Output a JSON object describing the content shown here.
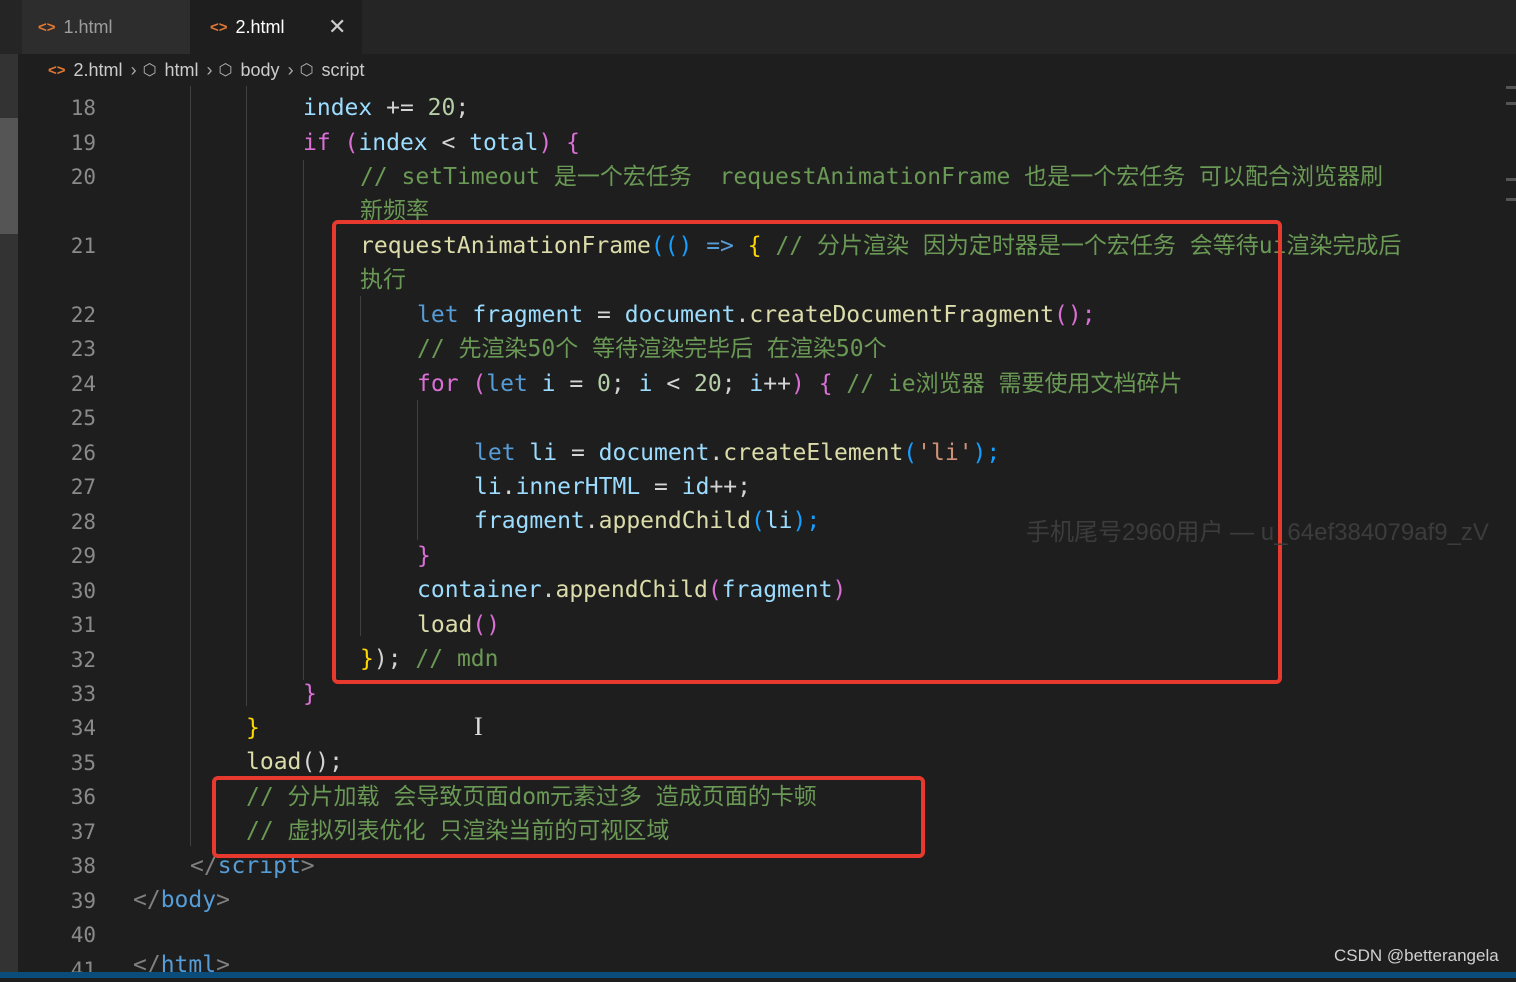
{
  "tabs": [
    {
      "label": "1.html",
      "icon": "code-file-icon"
    },
    {
      "label": "2.html",
      "icon": "code-file-icon",
      "close": "✕"
    }
  ],
  "breadcrumb": [
    "2.html",
    "html",
    "body",
    "script"
  ],
  "line_numbers": [
    "18",
    "19",
    "20",
    "",
    "21",
    "",
    "22",
    "23",
    "24",
    "25",
    "26",
    "27",
    "28",
    "29",
    "30",
    "31",
    "32",
    "33",
    "34",
    "35",
    "36",
    "37",
    "38",
    "39",
    "40",
    "41"
  ],
  "code": {
    "l18": {
      "a": "index",
      "b": " += ",
      "c": "20",
      "d": ";"
    },
    "l19": {
      "a": "if",
      "b": " (",
      "c": "index",
      "d": " < ",
      "e": "total",
      "f": ") ",
      "g": "{"
    },
    "l20": "// setTimeout 是一个宏任务  requestAnimationFrame 也是一个宏任务 可以配合浏览器刷",
    "l20b": "新频率",
    "l21": {
      "a": "requestAnimationFrame",
      "b": "((",
      "c": ") ",
      "d": "=>",
      "e": " {",
      "f": " // 分片渲染 因为定时器是一个宏任务 会等待ui渲染完成后"
    },
    "l21b": "执行",
    "l22": {
      "a": "let",
      "b": " fragment",
      "c": " = ",
      "d": "document",
      "e": ".",
      "f": "createDocumentFragment",
      "g": "();"
    },
    "l23": "// 先渲染50个 等待渲染完毕后 在渲染50个",
    "l24": {
      "a": "for",
      "b": " (",
      "c": "let",
      "d": " i",
      "e": " = ",
      "f": "0",
      "g": "; ",
      "h": "i",
      "i": " < ",
      "j": "20",
      "k": "; ",
      "l": "i",
      "m": "++",
      "n": ") ",
      "o": "{",
      "p": " // ie浏览器 需要使用文档碎片"
    },
    "l26": {
      "a": "let",
      "b": " li",
      "c": " = ",
      "d": "document",
      "e": ".",
      "f": "createElement",
      "g": "(",
      "h": "'li'",
      "i": ");"
    },
    "l27": {
      "a": "li",
      "b": ".",
      "c": "innerHTML",
      "d": " = ",
      "e": "id",
      "f": "++;"
    },
    "l28": {
      "a": "fragment",
      "b": ".",
      "c": "appendChild",
      "d": "(",
      "e": "li",
      "f": ");"
    },
    "l29": "}",
    "l30": {
      "a": "container",
      "b": ".",
      "c": "appendChild",
      "d": "(",
      "e": "fragment",
      "f": ")"
    },
    "l31": {
      "a": "load",
      "b": "()"
    },
    "l32": {
      "a": "}",
      "b": ");",
      "c": " // mdn"
    },
    "l33": "}",
    "l34": "}",
    "l35": {
      "a": "load",
      "b": "();"
    },
    "l36": "// 分片加载 会导致页面dom元素过多 造成页面的卡顿",
    "l37": "// 虚拟列表优化 只渲染当前的可视区域",
    "l38": {
      "a": "</",
      "b": "script",
      "c": ">"
    },
    "l39": {
      "a": "</",
      "b": "body",
      "c": ">"
    },
    "l41": {
      "a": "</",
      "b": "html",
      "c": ">"
    }
  },
  "watermark": "手机尾号2960用户 — u_64ef384079af9_zV",
  "credit": "CSDN @betterangela",
  "colors": {
    "highlight_box": "#e8392f",
    "keyword": "#569cd6",
    "comment": "#6a9955",
    "variable": "#9cdcfe",
    "function": "#dcdcaa"
  }
}
